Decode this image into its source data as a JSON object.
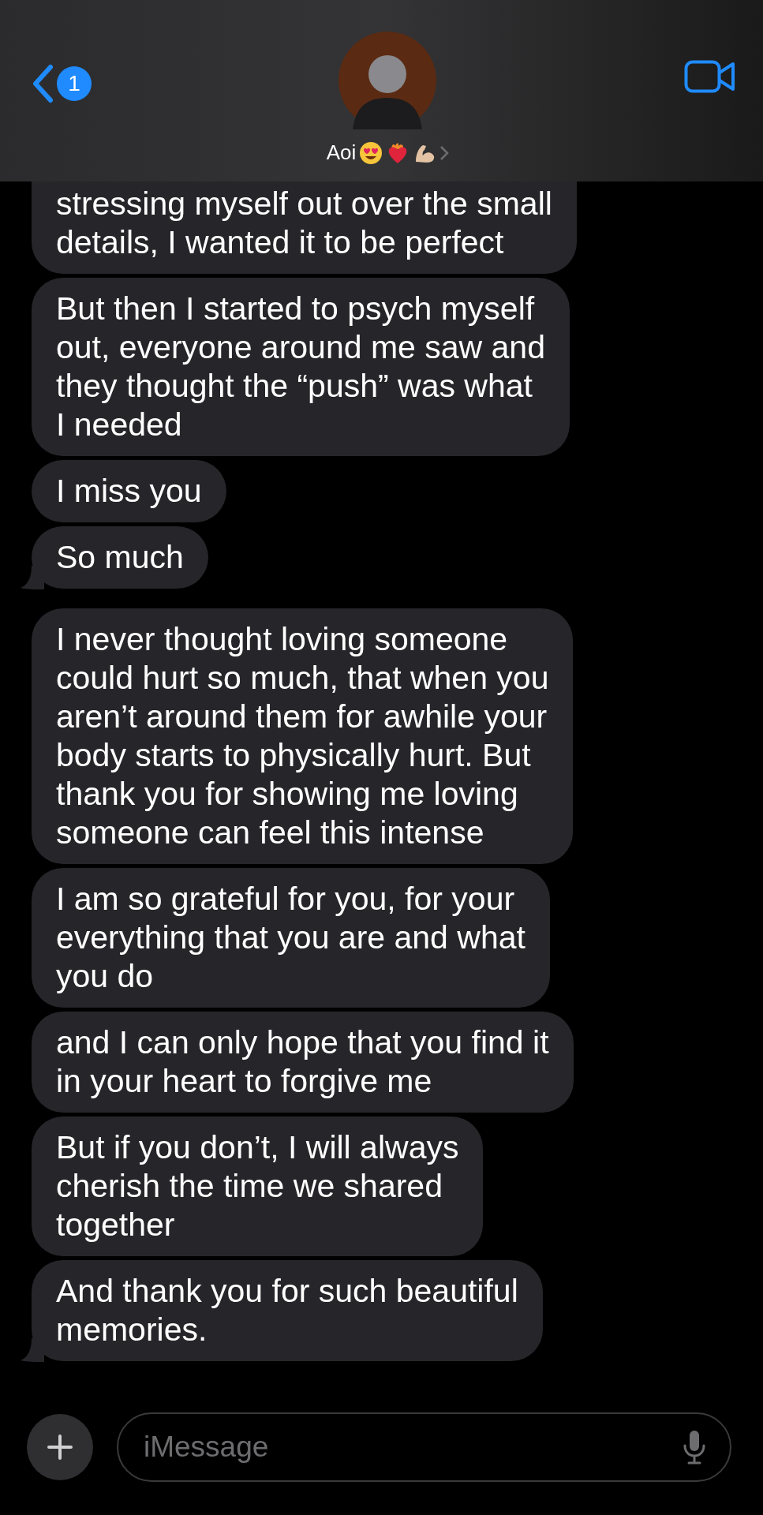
{
  "header": {
    "back_badge": "1",
    "contact_name": "Aoi"
  },
  "messages": [
    {
      "lines": [
        "stressing myself out over the small",
        "details, I wanted it to be perfect"
      ],
      "tail": false
    },
    {
      "lines": [
        "But then I started to psych myself",
        "out, everyone around me saw and",
        "they thought the “push” was what",
        "I needed"
      ],
      "tail": false
    },
    {
      "lines": [
        "I miss you"
      ],
      "tail": false
    },
    {
      "lines": [
        "So much"
      ],
      "tail": true
    },
    {
      "lines": [
        "I never thought loving someone",
        "could hurt so much, that when you",
        "aren’t around them for awhile your",
        "body starts to physically hurt. But",
        "thank you for showing me loving",
        "someone can feel this intense"
      ],
      "tail": false
    },
    {
      "lines": [
        "I am so grateful for you, for your",
        "everything that you are and what",
        "you do"
      ],
      "tail": false
    },
    {
      "lines": [
        "and I can only hope that you find it",
        "in your heart to forgive me"
      ],
      "tail": false
    },
    {
      "lines": [
        "But if you don’t, I will always",
        "cherish the time we shared",
        "together"
      ],
      "tail": false
    },
    {
      "lines": [
        "And thank you for such beautiful",
        "memories."
      ],
      "tail": true
    }
  ],
  "composer": {
    "placeholder": "iMessage"
  }
}
